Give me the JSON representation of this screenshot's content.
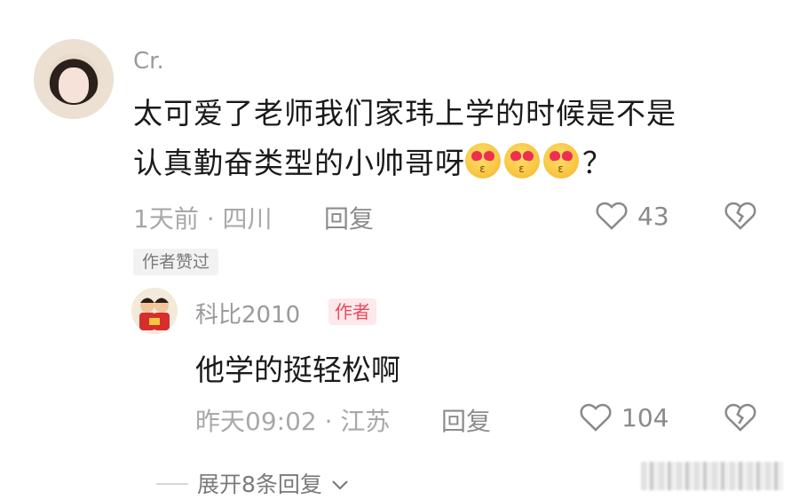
{
  "comment": {
    "username": "Cr.",
    "text_line1": "太可爱了老师我们家玮上学的时候是不是",
    "text_line2": "认真勤奋类型的小帅哥呀",
    "text_tail": "？",
    "emoji_name": "heart-eyes-emoji",
    "time_location": "1天前 · 四川",
    "reply_label": "回复",
    "likes": "43",
    "liked_badge": "作者赞过"
  },
  "reply": {
    "username": "科比2010",
    "author_tag": "作者",
    "text": "他学的挺轻松啊",
    "time_location": "昨天09:02 · 江苏",
    "reply_label": "回复",
    "likes": "104"
  },
  "expand_label": "展开8条回复",
  "colors": {
    "author_tag_bg": "#fde8ea",
    "author_tag_text": "#e84a5f",
    "meta_gray": "#a8a8a8"
  }
}
